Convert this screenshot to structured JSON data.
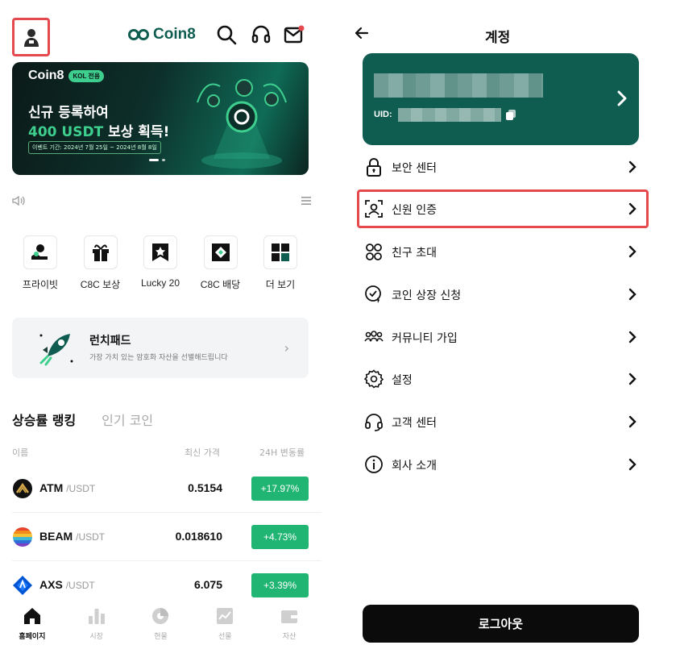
{
  "left": {
    "brand": "Coin8",
    "banner": {
      "logo": "Coin8",
      "badge": "KOL 전용",
      "line1": "신규 등록하여",
      "line2_accent": "400 USDT",
      "line2_rest": " 보상 획득!",
      "period": "이벤트 기간: 2024년 7월 25일 ~ 2024년 8월 8일"
    },
    "quick_items": [
      {
        "label": "프라이빗",
        "icon": "private-icon"
      },
      {
        "label": "C8C 보상",
        "icon": "gift-icon"
      },
      {
        "label": "Lucky 20",
        "icon": "lucky-icon"
      },
      {
        "label": "C8C 배당",
        "icon": "dividend-icon"
      },
      {
        "label": "더 보기",
        "icon": "more-icon"
      }
    ],
    "launchpad": {
      "title": "런치패드",
      "desc": "가장 가치 있는 암호화 자산을 선별해드립니다"
    },
    "tabs": {
      "active": "상승률 랭킹",
      "inactive": "인기 코인"
    },
    "columns": {
      "name": "이름",
      "price": "최신 가격",
      "change": "24H 변동률"
    },
    "rows": [
      {
        "symbol": "ATM",
        "quote": "/USDT",
        "price": "0.5154",
        "change": "+17.97%"
      },
      {
        "symbol": "BEAM",
        "quote": "/USDT",
        "price": "0.018610",
        "change": "+4.73%"
      },
      {
        "symbol": "AXS",
        "quote": "/USDT",
        "price": "6.075",
        "change": "+3.39%"
      }
    ],
    "nav": [
      {
        "label": "홈페이지",
        "active": true
      },
      {
        "label": "시장",
        "active": false
      },
      {
        "label": "현물",
        "active": false
      },
      {
        "label": "선물",
        "active": false
      },
      {
        "label": "자산",
        "active": false
      }
    ]
  },
  "right": {
    "title": "계정",
    "uid_label": "UID:",
    "menu": [
      {
        "label": "보안 센터",
        "icon": "lock-icon"
      },
      {
        "label": "신원 인증",
        "icon": "face-scan-icon"
      },
      {
        "label": "친구 초대",
        "icon": "invite-friends-icon"
      },
      {
        "label": "코인 상장 신청",
        "icon": "listing-apply-icon"
      },
      {
        "label": "커뮤니티 가입",
        "icon": "community-icon"
      },
      {
        "label": "설정",
        "icon": "settings-gear-icon"
      },
      {
        "label": "고객 센터",
        "icon": "headset-icon"
      },
      {
        "label": "회사 소개",
        "icon": "info-icon"
      }
    ],
    "logout": "로그아웃"
  },
  "colors": {
    "brand": "#0f5c50",
    "up": "#21b573",
    "highlight": "#e5484d"
  }
}
